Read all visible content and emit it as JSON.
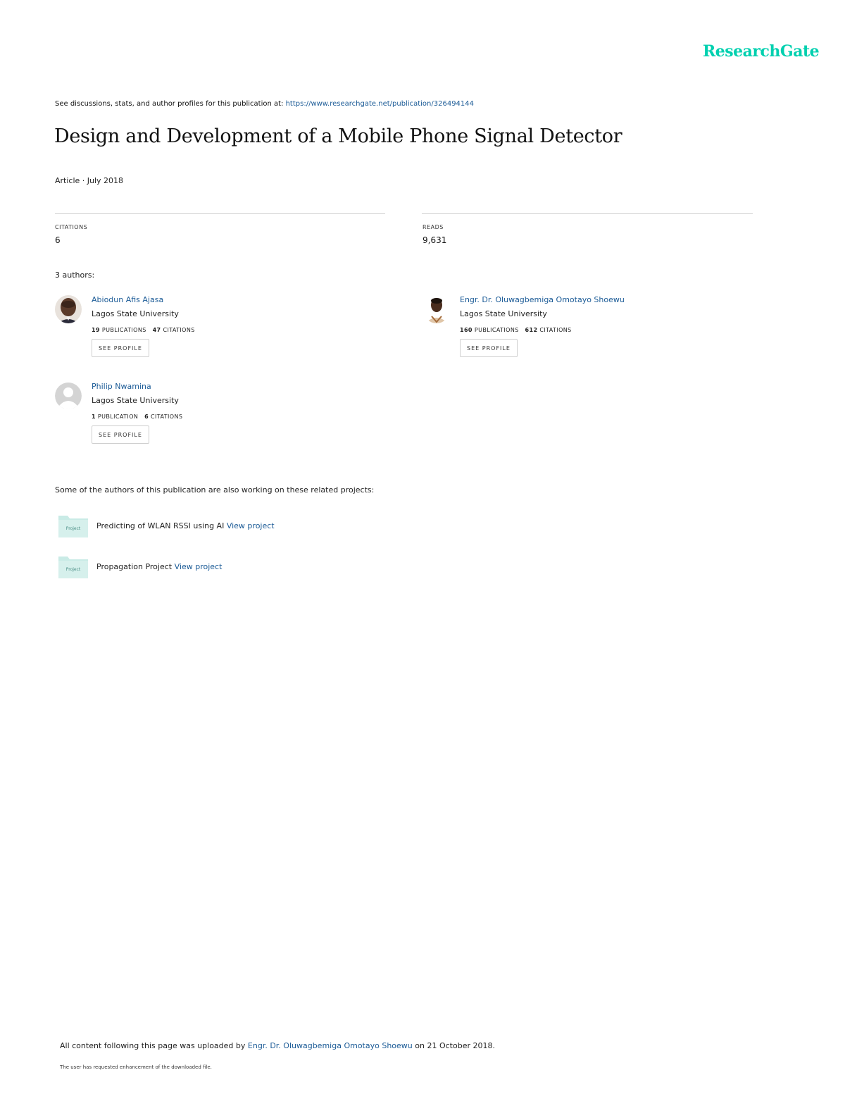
{
  "brand": "ResearchGate",
  "header": {
    "see_text": "See discussions, stats, and author profiles for this publication at:",
    "url": "https://www.researchgate.net/publication/326494144"
  },
  "paper": {
    "title": "Design and Development of a Mobile Phone Signal Detector",
    "meta": "Article · July 2018"
  },
  "stats": {
    "citations_label": "CITATIONS",
    "citations_value": "6",
    "reads_label": "READS",
    "reads_value": "9,631"
  },
  "authors_heading": "3 authors:",
  "authors": [
    {
      "name": "Abiodun Afis Ajasa",
      "institution": "Lagos State University",
      "pubs": "19",
      "pubs_label": "PUBLICATIONS",
      "cites": "47",
      "cites_label": "CITATIONS",
      "button": "SEE PROFILE"
    },
    {
      "name": "Engr. Dr. Oluwagbemiga Omotayo Shoewu",
      "institution": "Lagos State University",
      "pubs": "160",
      "pubs_label": "PUBLICATIONS",
      "cites": "612",
      "cites_label": "CITATIONS",
      "button": "SEE PROFILE"
    },
    {
      "name": "Philip Nwamina",
      "institution": "Lagos State University",
      "pubs": "1",
      "pubs_label": "PUBLICATION",
      "cites": "6",
      "cites_label": "CITATIONS",
      "button": "SEE PROFILE"
    }
  ],
  "related_heading": "Some of the authors of this publication are also working on these related projects:",
  "projects": [
    {
      "name": "Predicting of WLAN RSSI using AI",
      "link": "View project",
      "icon_label": "Project"
    },
    {
      "name": "Propagation Project",
      "link": "View project",
      "icon_label": "Project"
    }
  ],
  "footer": {
    "upload_prefix": "All content following this page was uploaded by",
    "uploader": "Engr. Dr. Oluwagbemiga Omotayo Shoewu",
    "upload_suffix": "on 21 October 2018.",
    "note": "The user has requested enhancement of the downloaded file."
  },
  "colors": {
    "brand": "#00d0af",
    "link": "#1a5a96",
    "folder": "#c9ebe6"
  }
}
